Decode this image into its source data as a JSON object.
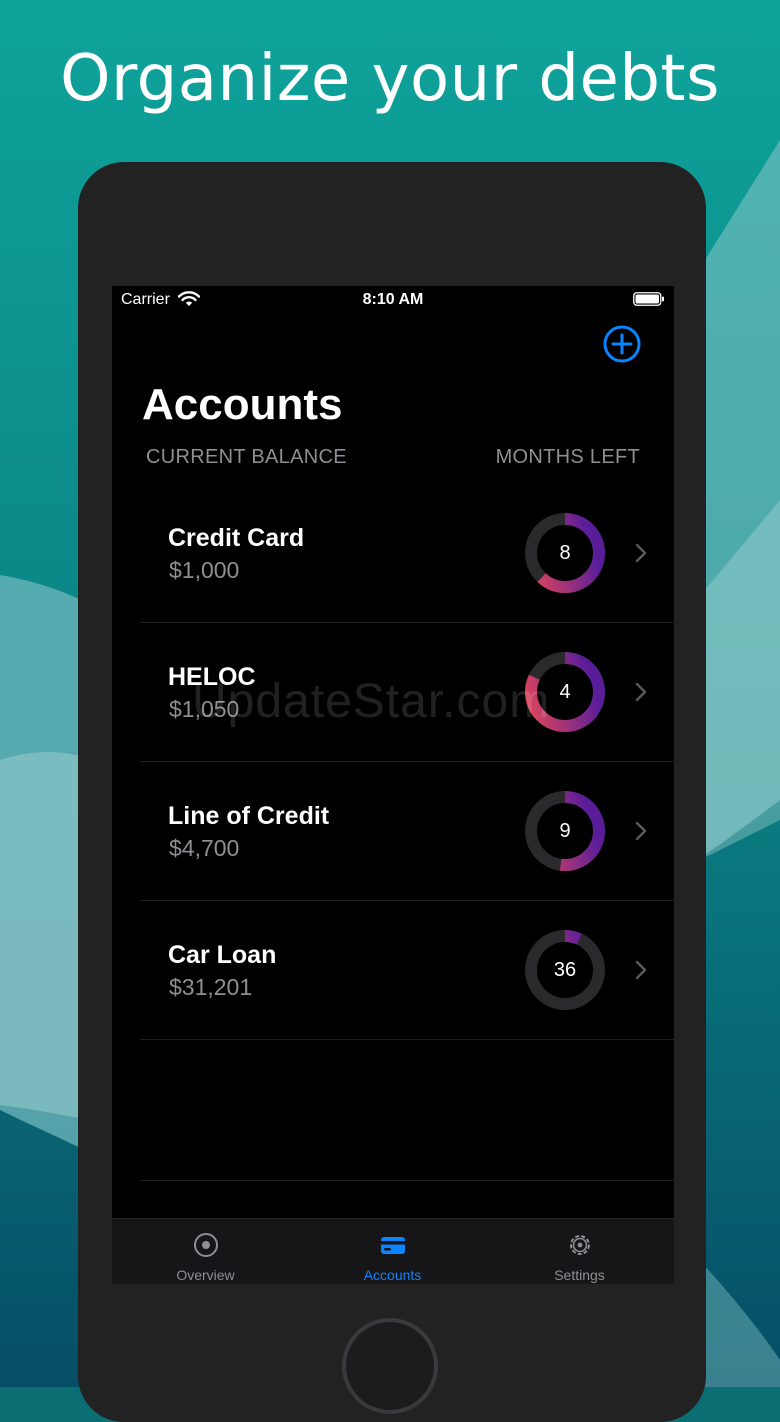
{
  "promo": {
    "title": "Organize your debts"
  },
  "colors": {
    "accent": "#0a84ff",
    "ring_start": "#e0465a",
    "ring_end": "#5a1d9a",
    "ring_track": "#2a2a2c",
    "background": "#0b6e73"
  },
  "status_bar": {
    "carrier": "Carrier",
    "time": "8:10 AM"
  },
  "header": {
    "title": "Accounts",
    "add_icon": "plus-circle-icon",
    "col_left": "CURRENT BALANCE",
    "col_right": "MONTHS LEFT"
  },
  "accounts": [
    {
      "name": "Credit Card",
      "balance": "$1,000",
      "months_left": "8",
      "progress": 0.62
    },
    {
      "name": "HELOC",
      "balance": "$1,050",
      "months_left": "4",
      "progress": 0.82
    },
    {
      "name": "Line of Credit",
      "balance": "$4,700",
      "months_left": "9",
      "progress": 0.52
    },
    {
      "name": "Car Loan",
      "balance": "$31,201",
      "months_left": "36",
      "progress": 0.07
    }
  ],
  "watermark": "UpdateStar.com",
  "tabs": [
    {
      "label": "Overview",
      "icon": "overview-circle-icon",
      "active": false
    },
    {
      "label": "Accounts",
      "icon": "credit-card-icon",
      "active": true
    },
    {
      "label": "Settings",
      "icon": "gear-icon",
      "active": false
    }
  ]
}
